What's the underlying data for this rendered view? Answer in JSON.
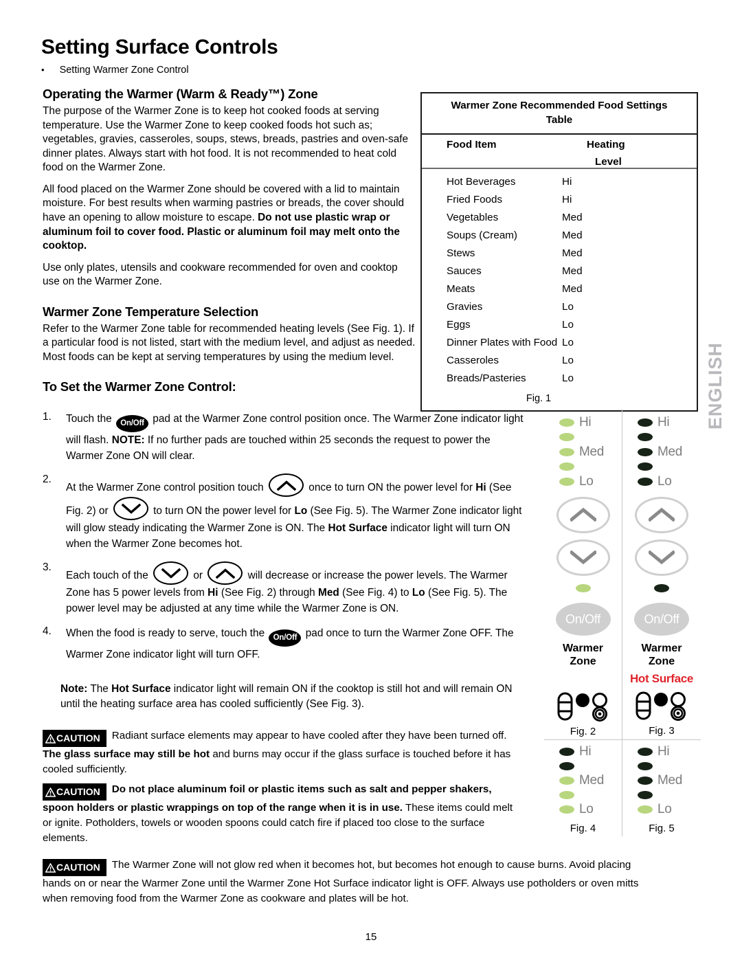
{
  "header": {
    "title": "Setting Surface Controls",
    "bullet": "Setting Warmer Zone Control"
  },
  "sidebar": {
    "language_tab": "ENGLISH"
  },
  "page_number": "15",
  "sections": {
    "operating": {
      "heading": "Operating the Warmer (Warm & Ready™) Zone",
      "p1": "The purpose of the Warmer Zone is to keep hot cooked foods at serving temperature. Use the Warmer Zone to keep cooked foods hot such as; vegetables, gravies, casseroles, soups, stews, breads, pastries and oven-safe dinner plates.  Always start with hot food. It is not recommended to heat cold food on the Warmer Zone.",
      "p2_a": "All food placed on the Warmer Zone should be covered with a lid to maintain moisture.  For best results when warming pastries or breads, the cover should have an opening to allow moisture to escape. ",
      "p2_bold": "Do not use plastic wrap or aluminum foil to cover food. Plastic or aluminum foil may melt onto the cooktop.",
      "p3": "Use only plates, utensils and cookware recommended for oven and cooktop use on the Warmer Zone."
    },
    "temperature": {
      "heading": "Warmer Zone Temperature Selection",
      "p1": "Refer to the Warmer Zone table for recommended heating levels (See Fig. 1). If a particular food is not listed, start with the medium level, and adjust as needed. Most foods can be kept at serving temperatures by using the medium level."
    },
    "to_set": {
      "heading": "To Set the Warmer Zone Control:"
    }
  },
  "steps": [
    {
      "num": "1.",
      "a": "Touch the ",
      "pad": "On/Off",
      "b": " pad at the Warmer Zone control position once. The Warmer Zone indicator light will flash. ",
      "bold1": "NOTE:",
      "c": " If no further pads are touched within 25 seconds the request to power the Warmer Zone ON will clear."
    },
    {
      "num": "2.",
      "a": "At the Warmer Zone control position touch ",
      "b": " once to turn ON the power level for ",
      "bold1": "Hi",
      "c": " (See Fig. 2) or ",
      "d": " to turn ON the power level for ",
      "bold2": "Lo",
      "e": " (See Fig. 5). The Warmer Zone indicator light will glow steady indicating the Warmer Zone is ON. The ",
      "bold3": "Hot Surface",
      "f": " indicator light will turn ON when the Warmer Zone becomes hot."
    },
    {
      "num": "3.",
      "a": "Each touch of the ",
      "b": " or ",
      "c": " will decrease or increase the power levels. The Warmer Zone has 5 power levels from ",
      "bold1": "Hi",
      "d": " (See Fig. 2) through ",
      "bold2": "Med",
      "e": " (See Fig. 4) to ",
      "bold3": "Lo",
      "f": " (See Fig. 5). The power level may be adjusted at any time while the Warmer Zone is ON."
    },
    {
      "num": "4.",
      "a": "When the food is ready to serve, touch the ",
      "pad": "On/Off",
      "b": " pad once to turn the Warmer Zone OFF. The Warmer Zone indicator light will turn OFF."
    }
  ],
  "note": {
    "bold1": "Note:",
    "a": " The ",
    "bold2": "Hot Surface",
    "b": " indicator light will remain ON if the cooktop is still hot and will remain ON until the heating surface area has cooled sufficiently (See Fig. 3)."
  },
  "cautions": [
    {
      "badge": "CAUTION",
      "a": "Radiant surface elements may appear to have cooled after they have been turned off. ",
      "bold": "The glass surface may still be hot",
      "b": " and burns may occur if the glass surface is touched before it has cooled sufficiently."
    },
    {
      "badge": "CAUTION",
      "bold": "Do not place aluminum foil or plastic items such as salt and pepper shakers, spoon holders or plastic wrappings on top of the range when it is in use.",
      "b": " These items could melt or ignite. Potholders, towels or wooden spoons could catch fire if placed too close to the surface elements."
    },
    {
      "badge": "CAUTION",
      "a": "The Warmer Zone will not glow red when it becomes hot, but becomes hot enough to cause burns. Avoid placing hands on or near the Warmer Zone until the Warmer Zone Hot Surface indicator light is OFF. Always use potholders or oven mitts when removing food from the Warmer Zone as cookware and plates will be hot."
    }
  ],
  "food_table": {
    "title": "Warmer Zone Recommended Food Settings Table",
    "columns": {
      "food": "Food Item",
      "level_line1": "Heating",
      "level_line2": "Level"
    },
    "rows": [
      {
        "food": "Hot Beverages",
        "level": "Hi"
      },
      {
        "food": "Fried Foods",
        "level": "Hi"
      },
      {
        "food": "Vegetables",
        "level": "Med"
      },
      {
        "food": "Soups (Cream)",
        "level": "Med"
      },
      {
        "food": "Stews",
        "level": "Med"
      },
      {
        "food": "Sauces",
        "level": "Med"
      },
      {
        "food": "Meats",
        "level": "Med"
      },
      {
        "food": "Gravies",
        "level": "Lo"
      },
      {
        "food": "Eggs",
        "level": "Lo"
      },
      {
        "food": "Dinner Plates with Food",
        "level": "Lo"
      },
      {
        "food": "Casseroles",
        "level": "Lo"
      },
      {
        "food": "Breads/Pasteries",
        "level": "Lo"
      }
    ],
    "caption": "Fig. 1"
  },
  "figures": {
    "colors": {
      "led_on": "#b8d67e",
      "led_off": "#182318",
      "hot_surface": "#e0242a",
      "button_gray": "#cfcfcf"
    },
    "led_labels": {
      "hi": "Hi",
      "med": "Med",
      "lo": "Lo"
    },
    "onoff_label": "On/Off",
    "warmer_zone_line1": "Warmer",
    "warmer_zone_line2": "Zone",
    "hot_surface_label": "Hot Surface",
    "fig2": {
      "caption": "Fig. 2",
      "leds": [
        true,
        true,
        true,
        true,
        true
      ],
      "hot_surface_on": false
    },
    "fig3": {
      "caption": "Fig. 3",
      "leds": [
        false,
        false,
        false,
        false,
        false
      ],
      "hot_surface_on": true
    },
    "fig4": {
      "caption": "Fig. 4",
      "leds": [
        false,
        false,
        true,
        true,
        true
      ]
    },
    "fig5": {
      "caption": "Fig. 5",
      "leds": [
        false,
        false,
        false,
        false,
        true
      ]
    }
  }
}
